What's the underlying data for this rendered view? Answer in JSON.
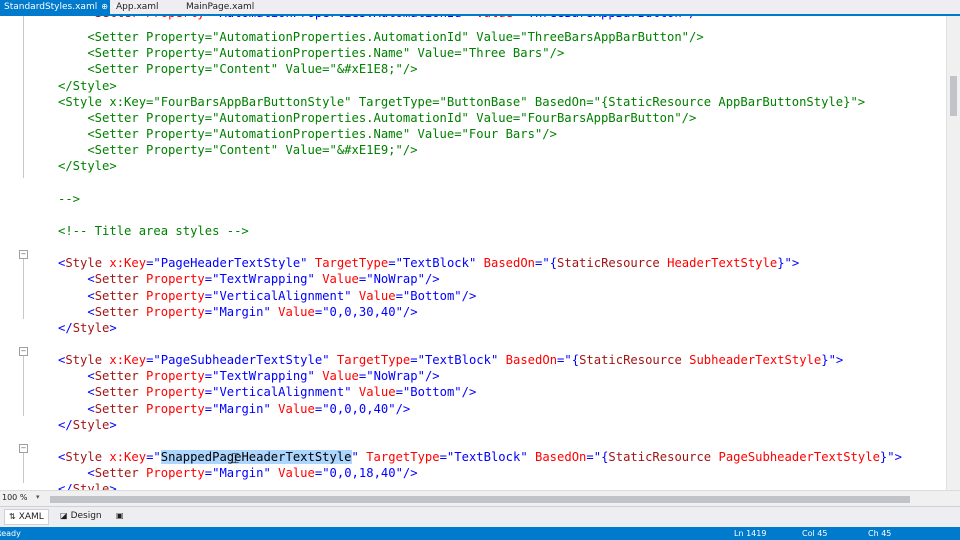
{
  "tabs": [
    {
      "label": "StandardStyles.xaml",
      "active": true,
      "pin": "⊕",
      "close": "×"
    },
    {
      "label": "App.xaml",
      "active": false
    },
    {
      "label": "MainPage.xaml",
      "active": false
    }
  ],
  "code_lines": [
    {
      "tokens": [
        [
          "a",
          "    <"
        ],
        [
          "e",
          "Setter"
        ],
        [
          "a",
          " Property"
        ],
        [
          "v",
          "=\"AutomationProperties.AutomationId\""
        ],
        [
          "a",
          " Value"
        ],
        [
          "v",
          "=\"ThreeBarsAppBarButton\""
        ],
        [
          "v",
          "/>"
        ]
      ],
      "comment": true
    },
    {
      "tokens": [
        [
          "c",
          "    <Setter Property=\"AutomationProperties.AutomationId\" Value=\"ThreeBarsAppBarButton\"/>"
        ]
      ]
    },
    {
      "tokens": [
        [
          "c",
          "    <Setter Property=\"AutomationProperties.Name\" Value=\"Three Bars\"/>"
        ]
      ]
    },
    {
      "tokens": [
        [
          "c",
          "    <Setter Property=\"Content\" Value=\"&#xE1E8;\"/>"
        ]
      ]
    },
    {
      "tokens": [
        [
          "c",
          "</Style>"
        ]
      ]
    },
    {
      "tokens": [
        [
          "c",
          "<Style x:Key=\"FourBarsAppBarButtonStyle\" TargetType=\"ButtonBase\" BasedOn=\"{StaticResource AppBarButtonStyle}\">"
        ]
      ]
    },
    {
      "tokens": [
        [
          "c",
          "    <Setter Property=\"AutomationProperties.AutomationId\" Value=\"FourBarsAppBarButton\"/>"
        ]
      ]
    },
    {
      "tokens": [
        [
          "c",
          "    <Setter Property=\"AutomationProperties.Name\" Value=\"Four Bars\"/>"
        ]
      ]
    },
    {
      "tokens": [
        [
          "c",
          "    <Setter Property=\"Content\" Value=\"&#xE1E9;\"/>"
        ]
      ]
    },
    {
      "tokens": [
        [
          "c",
          "</Style>"
        ]
      ]
    },
    {
      "tokens": []
    },
    {
      "tokens": [
        [
          "c",
          "-->"
        ]
      ]
    },
    {
      "tokens": []
    },
    {
      "tokens": [
        [
          "c",
          "<!-- Title area styles -->"
        ]
      ]
    },
    {
      "tokens": []
    },
    {
      "tokens": [
        [
          "t",
          "<"
        ],
        [
          "e",
          "Style"
        ],
        [
          "a",
          " x:Key"
        ],
        [
          "t",
          "=\""
        ],
        [
          "v",
          "PageHeaderTextStyle"
        ],
        [
          "t",
          "\""
        ],
        [
          "a",
          " TargetType"
        ],
        [
          "t",
          "=\""
        ],
        [
          "v",
          "TextBlock"
        ],
        [
          "t",
          "\""
        ],
        [
          "a",
          " BasedOn"
        ],
        [
          "t",
          "=\""
        ],
        [
          "v",
          "{"
        ],
        [
          "e",
          "StaticResource"
        ],
        [
          "a",
          " HeaderTextStyle"
        ],
        [
          "v",
          "}"
        ],
        [
          "t",
          "\">"
        ]
      ]
    },
    {
      "tokens": [
        [
          "t",
          "    <"
        ],
        [
          "e",
          "Setter"
        ],
        [
          "a",
          " Property"
        ],
        [
          "t",
          "=\""
        ],
        [
          "v",
          "TextWrapping"
        ],
        [
          "t",
          "\""
        ],
        [
          "a",
          " Value"
        ],
        [
          "t",
          "=\""
        ],
        [
          "v",
          "NoWrap"
        ],
        [
          "t",
          "\"/>"
        ]
      ]
    },
    {
      "tokens": [
        [
          "t",
          "    <"
        ],
        [
          "e",
          "Setter"
        ],
        [
          "a",
          " Property"
        ],
        [
          "t",
          "=\""
        ],
        [
          "v",
          "VerticalAlignment"
        ],
        [
          "t",
          "\""
        ],
        [
          "a",
          " Value"
        ],
        [
          "t",
          "=\""
        ],
        [
          "v",
          "Bottom"
        ],
        [
          "t",
          "\"/>"
        ]
      ]
    },
    {
      "tokens": [
        [
          "t",
          "    <"
        ],
        [
          "e",
          "Setter"
        ],
        [
          "a",
          " Property"
        ],
        [
          "t",
          "=\""
        ],
        [
          "v",
          "Margin"
        ],
        [
          "t",
          "\""
        ],
        [
          "a",
          " Value"
        ],
        [
          "t",
          "=\""
        ],
        [
          "v",
          "0,0,30,40"
        ],
        [
          "t",
          "\"/>"
        ]
      ]
    },
    {
      "tokens": [
        [
          "t",
          "</"
        ],
        [
          "e",
          "Style"
        ],
        [
          "t",
          ">"
        ]
      ]
    },
    {
      "tokens": []
    },
    {
      "tokens": [
        [
          "t",
          "<"
        ],
        [
          "e",
          "Style"
        ],
        [
          "a",
          " x:Key"
        ],
        [
          "t",
          "=\""
        ],
        [
          "v",
          "PageSubheaderTextStyle"
        ],
        [
          "t",
          "\""
        ],
        [
          "a",
          " TargetType"
        ],
        [
          "t",
          "=\""
        ],
        [
          "v",
          "TextBlock"
        ],
        [
          "t",
          "\""
        ],
        [
          "a",
          " BasedOn"
        ],
        [
          "t",
          "=\""
        ],
        [
          "v",
          "{"
        ],
        [
          "e",
          "StaticResource"
        ],
        [
          "a",
          " SubheaderTextStyle"
        ],
        [
          "v",
          "}"
        ],
        [
          "t",
          "\">"
        ]
      ]
    },
    {
      "tokens": [
        [
          "t",
          "    <"
        ],
        [
          "e",
          "Setter"
        ],
        [
          "a",
          " Property"
        ],
        [
          "t",
          "=\""
        ],
        [
          "v",
          "TextWrapping"
        ],
        [
          "t",
          "\""
        ],
        [
          "a",
          " Value"
        ],
        [
          "t",
          "=\""
        ],
        [
          "v",
          "NoWrap"
        ],
        [
          "t",
          "\"/>"
        ]
      ]
    },
    {
      "tokens": [
        [
          "t",
          "    <"
        ],
        [
          "e",
          "Setter"
        ],
        [
          "a",
          " Property"
        ],
        [
          "t",
          "=\""
        ],
        [
          "v",
          "VerticalAlignment"
        ],
        [
          "t",
          "\""
        ],
        [
          "a",
          " Value"
        ],
        [
          "t",
          "=\""
        ],
        [
          "v",
          "Bottom"
        ],
        [
          "t",
          "\"/>"
        ]
      ]
    },
    {
      "tokens": [
        [
          "t",
          "    <"
        ],
        [
          "e",
          "Setter"
        ],
        [
          "a",
          " Property"
        ],
        [
          "t",
          "=\""
        ],
        [
          "v",
          "Margin"
        ],
        [
          "t",
          "\""
        ],
        [
          "a",
          " Value"
        ],
        [
          "t",
          "=\""
        ],
        [
          "v",
          "0,0,0,40"
        ],
        [
          "t",
          "\"/>"
        ]
      ]
    },
    {
      "tokens": [
        [
          "t",
          "</"
        ],
        [
          "e",
          "Style"
        ],
        [
          "t",
          ">"
        ]
      ]
    },
    {
      "tokens": []
    },
    {
      "tokens": [
        [
          "t",
          "<"
        ],
        [
          "e",
          "Style"
        ],
        [
          "a",
          " x:Key"
        ],
        [
          "t",
          "=\""
        ],
        [
          "sel",
          "SnappedPageHeaderTextStyle"
        ],
        [
          "t",
          "\""
        ],
        [
          "a",
          " TargetType"
        ],
        [
          "t",
          "=\""
        ],
        [
          "v",
          "TextBlock"
        ],
        [
          "t",
          "\""
        ],
        [
          "a",
          " BasedOn"
        ],
        [
          "t",
          "=\""
        ],
        [
          "v",
          "{"
        ],
        [
          "e",
          "StaticResource"
        ],
        [
          "a",
          " PageSubheaderTextStyle"
        ],
        [
          "v",
          "}"
        ],
        [
          "t",
          "\">"
        ]
      ]
    },
    {
      "tokens": [
        [
          "t",
          "    <"
        ],
        [
          "e",
          "Setter"
        ],
        [
          "a",
          " Property"
        ],
        [
          "t",
          "=\""
        ],
        [
          "v",
          "Margin"
        ],
        [
          "t",
          "\""
        ],
        [
          "a",
          " Value"
        ],
        [
          "t",
          "=\""
        ],
        [
          "v",
          "0,0,18,40"
        ],
        [
          "t",
          "\"/>"
        ]
      ]
    },
    {
      "tokens": [
        [
          "t",
          "</"
        ],
        [
          "e",
          "Style"
        ],
        [
          "t",
          ">"
        ]
      ]
    }
  ],
  "zoom": "100 %",
  "view_tabs": [
    {
      "label": "XAML",
      "icon": "⇅",
      "selected": true
    },
    {
      "label": "Design",
      "icon": "◪",
      "selected": false
    },
    {
      "label": "",
      "icon": "▣",
      "selected": false
    }
  ],
  "status": {
    "state": "Ready",
    "line": "Ln 1419",
    "col": "Col 45",
    "ch": "Ch 45"
  }
}
